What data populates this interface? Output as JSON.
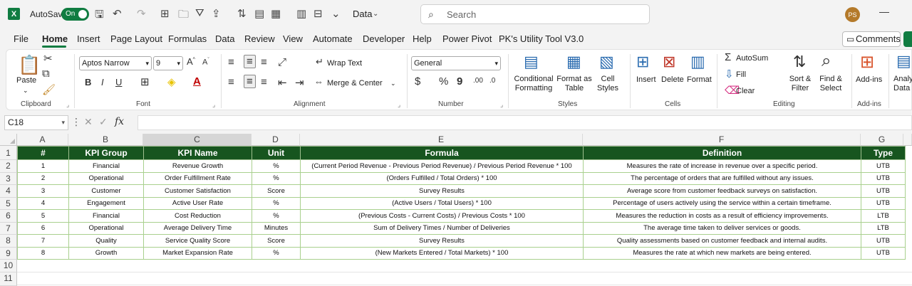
{
  "titlebar": {
    "logo_letter": "X",
    "autosave_label": "AutoSave",
    "autosave_state": "On",
    "document_name": "Data",
    "search_placeholder": "Search",
    "user_initials": "PS"
  },
  "ribbon_tabs": [
    "File",
    "Home",
    "Insert",
    "Page Layout",
    "Formulas",
    "Data",
    "Review",
    "View",
    "Automate",
    "Developer",
    "Help",
    "Power Pivot",
    "PK's Utility Tool V3.0"
  ],
  "active_tab": "Home",
  "comments_label": "Comments",
  "ribbon": {
    "clipboard": {
      "label": "Clipboard",
      "paste": "Paste"
    },
    "font": {
      "label": "Font",
      "name": "Aptos Narrow",
      "size": "9"
    },
    "alignment": {
      "label": "Alignment",
      "wrap_text": "Wrap Text",
      "merge_center": "Merge & Center"
    },
    "number": {
      "label": "Number",
      "format": "General"
    },
    "styles": {
      "label": "Styles",
      "conditional_1": "Conditional",
      "conditional_2": "Formatting",
      "format_as_1": "Format as",
      "format_as_2": "Table",
      "cell_styles_1": "Cell",
      "cell_styles_2": "Styles"
    },
    "cells": {
      "label": "Cells",
      "insert": "Insert",
      "delete": "Delete",
      "format": "Format"
    },
    "editing": {
      "label": "Editing",
      "autosum": "AutoSum",
      "fill": "Fill",
      "clear": "Clear",
      "sort_1": "Sort &",
      "sort_2": "Filter",
      "find_1": "Find &",
      "find_2": "Select"
    },
    "addins": {
      "label": "Add-ins",
      "button": "Add-ins"
    },
    "analyze": {
      "label_1": "Analy",
      "label_2": "Data"
    }
  },
  "formula_bar": {
    "name_box": "C18",
    "fx": "fx",
    "content": ""
  },
  "columns": [
    "A",
    "B",
    "C",
    "D",
    "E",
    "F",
    "G"
  ],
  "selected_column": "C",
  "rows": [
    "1",
    "2",
    "3",
    "4",
    "5",
    "6",
    "7",
    "8",
    "9",
    "10",
    "11"
  ],
  "table": {
    "headers": [
      "#",
      "KPI Group",
      "KPI Name",
      "Unit",
      "Formula",
      "Definition",
      "Type"
    ],
    "data": [
      [
        "1",
        "Financial",
        "Revenue Growth",
        "%",
        "(Current Period Revenue - Previous Period Revenue) / Previous Period Revenue * 100",
        "Measures the rate of increase in revenue over a specific period.",
        "UTB"
      ],
      [
        "2",
        "Operational",
        "Order Fulfillment Rate",
        "%",
        "(Orders Fulfilled / Total Orders) * 100",
        "The percentage of orders that are fulfilled without any issues.",
        "UTB"
      ],
      [
        "3",
        "Customer",
        "Customer Satisfaction",
        "Score",
        "Survey Results",
        "Average score from customer feedback surveys on satisfaction.",
        "UTB"
      ],
      [
        "4",
        "Engagement",
        "Active User Rate",
        "%",
        "(Active Users / Total Users) * 100",
        "Percentage of users actively using the service within a certain timeframe.",
        "UTB"
      ],
      [
        "5",
        "Financial",
        "Cost Reduction",
        "%",
        "(Previous Costs - Current Costs) / Previous Costs * 100",
        "Measures the reduction in costs as a result of efficiency improvements.",
        "LTB"
      ],
      [
        "6",
        "Operational",
        "Average Delivery Time",
        "Minutes",
        "Sum of Delivery Times / Number of Deliveries",
        "The average time taken to deliver services or goods.",
        "LTB"
      ],
      [
        "7",
        "Quality",
        "Service Quality Score",
        "Score",
        "Survey Results",
        "Quality assessments based on customer feedback and internal audits.",
        "UTB"
      ],
      [
        "8",
        "Growth",
        "Market Expansion Rate",
        "%",
        "(New Markets Entered / Total Markets) * 100",
        "Measures the rate at which new markets are being entered.",
        "UTB"
      ]
    ]
  },
  "colors": {
    "accent": "#107c41",
    "header_fill": "#17551f",
    "border": "#a9d08e"
  }
}
